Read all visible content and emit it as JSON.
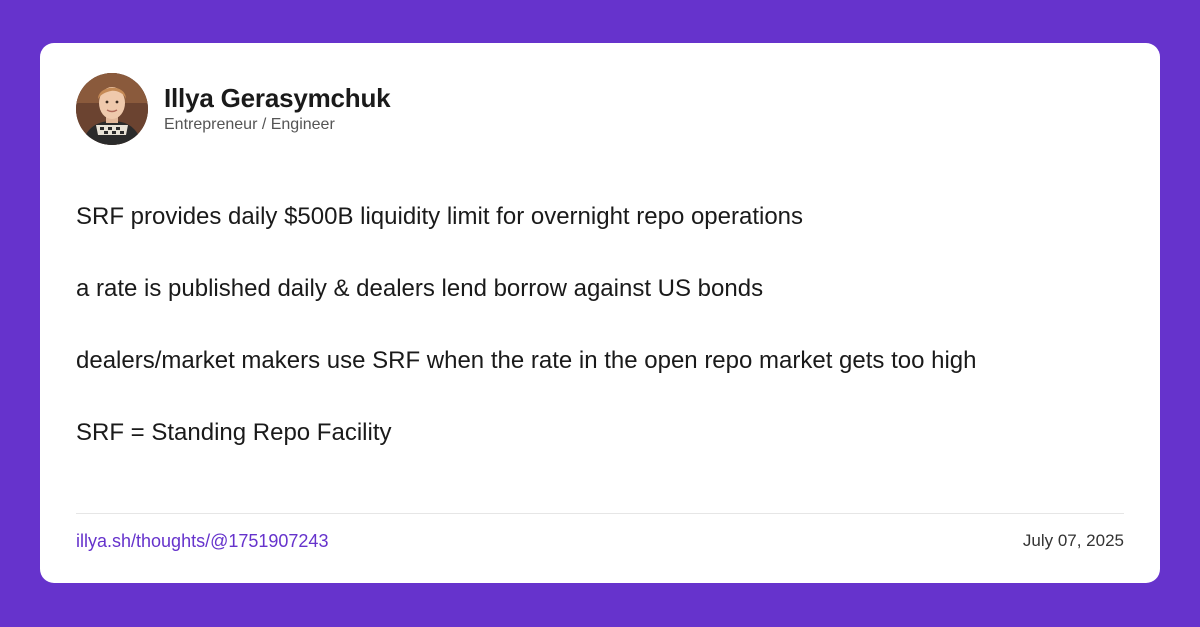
{
  "author": {
    "name": "Illya Gerasymchuk",
    "title": "Entrepreneur / Engineer"
  },
  "post": {
    "lines": [
      "SRF provides daily $500B liquidity limit for overnight repo operations",
      "a rate is published daily & dealers lend borrow against US bonds",
      "dealers/market makers use SRF when the rate in the open repo market gets too high",
      "SRF = Standing Repo Facility"
    ]
  },
  "footer": {
    "link": "illya.sh/thoughts/@1751907243",
    "date": "July 07, 2025"
  },
  "colors": {
    "background": "#6633cc",
    "card": "#ffffff",
    "link": "#6633cc"
  }
}
